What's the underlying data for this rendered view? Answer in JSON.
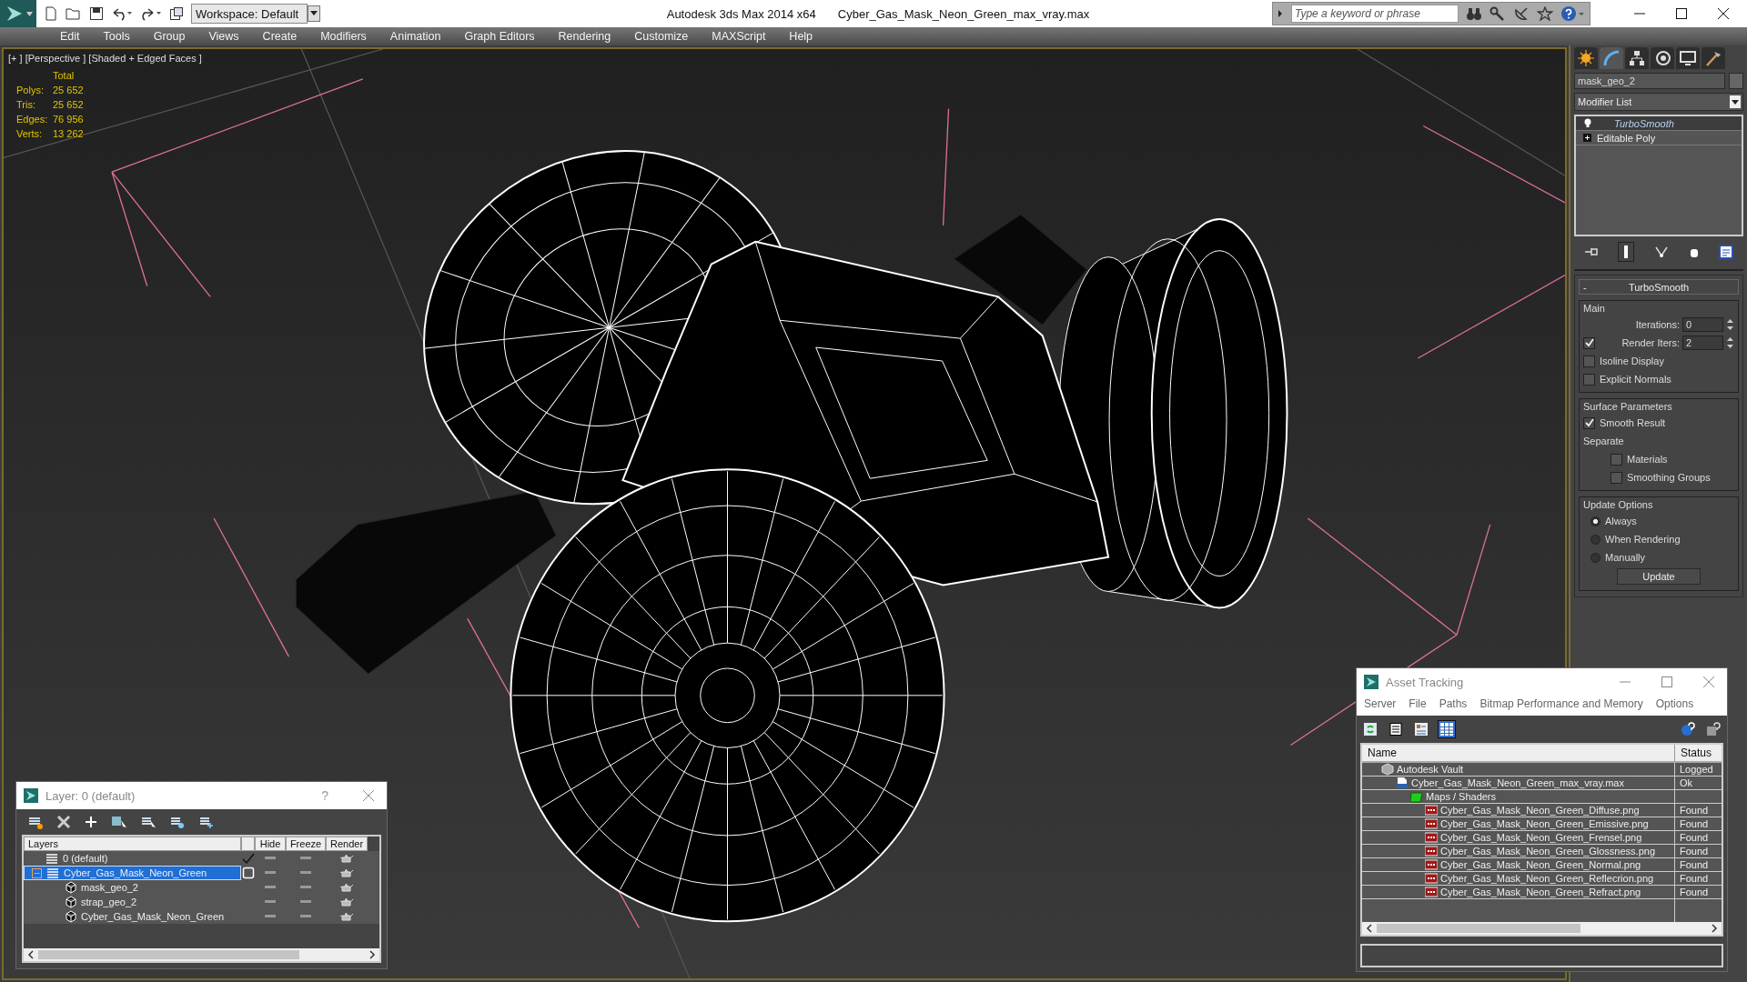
{
  "title_bar": {
    "workspace": "Workspace: Default",
    "app_title": "Autodesk 3ds Max  2014 x64",
    "file_title": "Cyber_Gas_Mask_Neon_Green_max_vray.max",
    "search": {
      "placeholder": "Type a keyword or phrase"
    }
  },
  "menu_bar": [
    "Edit",
    "Tools",
    "Group",
    "Views",
    "Create",
    "Modifiers",
    "Animation",
    "Graph Editors",
    "Rendering",
    "Customize",
    "MAXScript",
    "Help"
  ],
  "viewport": {
    "label": "[+ ] [Perspective ] [Shaded + Edged Faces ]",
    "stats_header": "Total",
    "stats": [
      {
        "label": "Polys:",
        "value": "25 652"
      },
      {
        "label": "Tris:",
        "value": "25 652"
      },
      {
        "label": "Edges:",
        "value": "76 956"
      },
      {
        "label": "Verts:",
        "value": "13 262"
      }
    ]
  },
  "command_panel": {
    "tabs": [
      {
        "kind": "create",
        "selected": false
      },
      {
        "kind": "modify",
        "selected": true
      },
      {
        "kind": "hierarchy",
        "selected": false
      },
      {
        "kind": "motion",
        "selected": false
      },
      {
        "kind": "display",
        "selected": false
      },
      {
        "kind": "utilities",
        "selected": false
      }
    ],
    "object_name": "mask_geo_2",
    "modifier_list": "Modifier List",
    "stack": [
      {
        "label": "TurboSmooth",
        "kind": "modifier",
        "selected": true
      },
      {
        "label": "Editable Poly",
        "kind": "base",
        "selected": false
      }
    ],
    "rollout": {
      "collapse": "-",
      "title": "TurboSmooth",
      "groups": [
        {
          "title": "Main",
          "items": [
            {
              "kind": "spinner",
              "label": "Iterations:",
              "value": "0"
            },
            {
              "kind": "spinner",
              "label": "Render Iters:",
              "value": "2",
              "checked": true
            },
            {
              "kind": "checkbox",
              "label": "Isoline Display",
              "checked": false
            },
            {
              "kind": "checkbox",
              "label": "Explicit Normals",
              "checked": false
            }
          ]
        },
        {
          "title": "Surface Parameters",
          "items": [
            {
              "kind": "checkbox",
              "label": "Smooth Result",
              "checked": true
            },
            {
              "kind": "label",
              "label": "Separate"
            },
            {
              "kind": "subcheckbox",
              "label": "Materials",
              "checked": false
            },
            {
              "kind": "subcheckbox",
              "label": "Smoothing Groups",
              "checked": false
            }
          ]
        },
        {
          "title": "Update Options",
          "items": [
            {
              "kind": "radio",
              "label": "Always",
              "selected": true
            },
            {
              "kind": "radio",
              "label": "When Rendering",
              "selected": false
            },
            {
              "kind": "radio",
              "label": "Manually",
              "selected": false
            },
            {
              "kind": "button",
              "label": "Update"
            }
          ]
        }
      ]
    }
  },
  "layer_dialog": {
    "title": "Layer: 0 (default)",
    "help": "?",
    "columns": [
      "Layers",
      "",
      "Hide",
      "Freeze",
      "Render"
    ],
    "rows": [
      {
        "name": "0 (default)",
        "kind": "layer",
        "current": true,
        "selected": false
      },
      {
        "name": "Cyber_Gas_Mask_Neon_Green",
        "kind": "layer",
        "current": false,
        "selected": true,
        "expanded": true,
        "children": [
          {
            "name": "mask_geo_2",
            "kind": "object",
            "selected": false
          },
          {
            "name": "strap_geo_2",
            "kind": "object",
            "selected": false
          },
          {
            "name": "Cyber_Gas_Mask_Neon_Green",
            "kind": "object",
            "selected": false
          }
        ]
      }
    ]
  },
  "asset_tracking": {
    "title": "Asset Tracking",
    "menu": [
      "Server",
      "File",
      "Paths",
      "Bitmap Performance and Memory",
      "Options"
    ],
    "tools": [
      {
        "kind": "refresh",
        "selected": false
      },
      {
        "kind": "list",
        "selected": false
      },
      {
        "kind": "details",
        "selected": false
      },
      {
        "kind": "table",
        "selected": true
      }
    ],
    "columns": [
      "Name",
      "Status"
    ],
    "rows": [
      {
        "name": "Autodesk Vault",
        "status": "Logged",
        "kind": "vault",
        "children": [
          {
            "name": "Cyber_Gas_Mask_Neon_Green_max_vray.max",
            "status": "Ok",
            "kind": "max",
            "children": [
              {
                "name": "Maps / Shaders",
                "kind": "folder",
                "children": [
                  {
                    "name": "Cyber_Gas_Mask_Neon_Green_Diffuse.png",
                    "status": "Found",
                    "kind": "png"
                  },
                  {
                    "name": "Cyber_Gas_Mask_Neon_Green_Emissive.png",
                    "status": "Found",
                    "kind": "png"
                  },
                  {
                    "name": "Cyber_Gas_Mask_Neon_Green_Frensel.png",
                    "status": "Found",
                    "kind": "png"
                  },
                  {
                    "name": "Cyber_Gas_Mask_Neon_Green_Glossness.png",
                    "status": "Found",
                    "kind": "png"
                  },
                  {
                    "name": "Cyber_Gas_Mask_Neon_Green_Normal.png",
                    "status": "Found",
                    "kind": "png"
                  },
                  {
                    "name": "Cyber_Gas_Mask_Neon_Green_Reflecrion.png",
                    "status": "Found",
                    "kind": "png"
                  },
                  {
                    "name": "Cyber_Gas_Mask_Neon_Green_Refract.png",
                    "status": "Found",
                    "kind": "png"
                  }
                ]
              }
            ]
          }
        ]
      }
    ]
  }
}
